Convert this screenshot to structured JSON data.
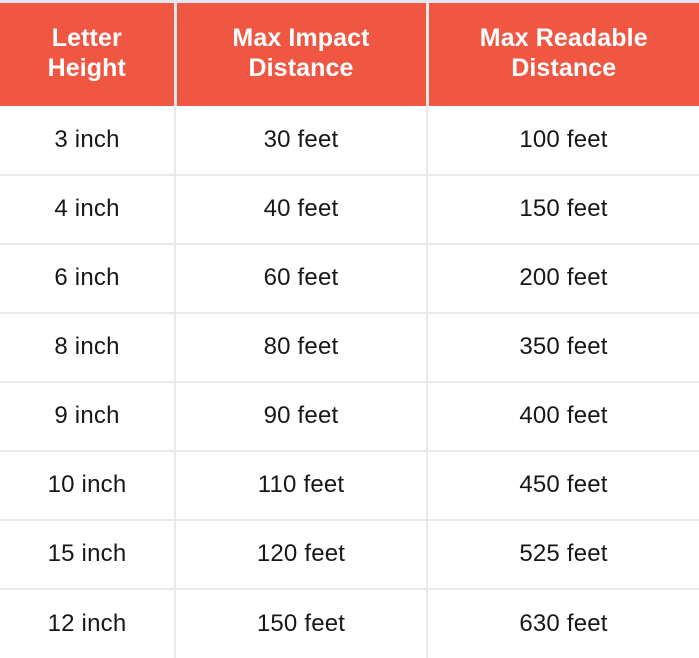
{
  "table": {
    "name": "letter-height-visibility-table",
    "accent_color": "#ef5743",
    "header_text_color": "#ffffff",
    "body_text_color": "#17171a",
    "grid_line_color": "#e9e9e9",
    "columns": [
      {
        "id": "letter-height",
        "label_line1": "Letter",
        "label_line2": "Height"
      },
      {
        "id": "max-impact-distance",
        "label_line1": "Max Impact",
        "label_line2": "Distance"
      },
      {
        "id": "max-readable-distance",
        "label_line1": "Max Readable",
        "label_line2": "Distance"
      }
    ],
    "rows": [
      {
        "letter_height": "3 inch",
        "max_impact_distance": "30 feet",
        "max_readable_distance": "100 feet"
      },
      {
        "letter_height": "4 inch",
        "max_impact_distance": "40 feet",
        "max_readable_distance": "150 feet"
      },
      {
        "letter_height": "6 inch",
        "max_impact_distance": "60 feet",
        "max_readable_distance": "200 feet"
      },
      {
        "letter_height": "8 inch",
        "max_impact_distance": "80 feet",
        "max_readable_distance": "350 feet"
      },
      {
        "letter_height": "9 inch",
        "max_impact_distance": "90 feet",
        "max_readable_distance": "400 feet"
      },
      {
        "letter_height": "10 inch",
        "max_impact_distance": "110 feet",
        "max_readable_distance": "450 feet"
      },
      {
        "letter_height": "15 inch",
        "max_impact_distance": "120 feet",
        "max_readable_distance": "525 feet"
      },
      {
        "letter_height": "12 inch",
        "max_impact_distance": "150 feet",
        "max_readable_distance": "630 feet"
      }
    ]
  }
}
